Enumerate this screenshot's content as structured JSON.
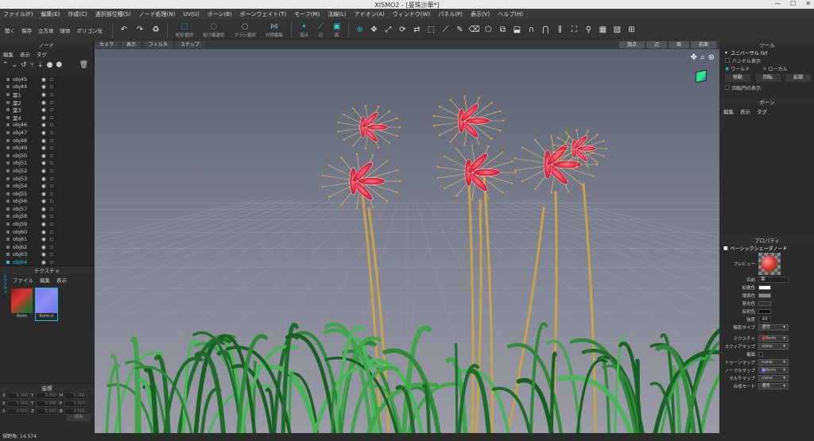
{
  "window": {
    "title": "XISMO2 - [曼珠沙華*]",
    "controls": [
      "—",
      "☐",
      "✕"
    ]
  },
  "menu": [
    "ファイル(F)",
    "編集(E)",
    "作成(C)",
    "選択部位種(S)",
    "ノード処理(N)",
    "UV(U)",
    "ボーン(B)",
    "ボーンウェイト(T)",
    "モーフ(M)",
    "法線(L)",
    "アドオン(A)",
    "ウィンドウ(W)",
    "パネル(P)",
    "表示(V)",
    "ヘルプ(H)"
  ],
  "toolbar": {
    "open": "開く",
    "save": "保存",
    "cube": "立方体",
    "sphere": "球体",
    "polygonize": "ポリゴン化",
    "groups": [
      {
        "label": "矩形選択",
        "active": true
      },
      {
        "label": "投げ縄選択",
        "active": false
      },
      {
        "label": "ブラシ選択",
        "active": false
      },
      {
        "label": "対称編集",
        "active": false
      },
      {
        "label": "頂点",
        "active": true
      },
      {
        "label": "辺",
        "active": true
      },
      {
        "label": "面",
        "active": true
      }
    ]
  },
  "node_panel": {
    "title": "ノード",
    "tabs": [
      "編集",
      "表示",
      "タグ"
    ],
    "items": [
      "obj45",
      "obj44",
      "葉1",
      "葉2",
      "葉3",
      "葉4",
      "obj46",
      "obj47",
      "obj48",
      "obj49",
      "obj50",
      "obj51",
      "obj52",
      "obj53",
      "obj54",
      "obj55",
      "obj56",
      "obj57",
      "obj58",
      "obj59",
      "obj60",
      "obj61",
      "obj62",
      "obj63",
      "obj64"
    ],
    "selected": "obj64"
  },
  "texture_panel": {
    "title": "テクスチャ",
    "tabs": [
      "ファイル",
      "編集",
      "表示"
    ],
    "side_tab": "テクスチャ",
    "thumbs": [
      {
        "label": "form",
        "color": "#c8262a"
      },
      {
        "label": "form-n",
        "color": "#7a7ef0"
      }
    ]
  },
  "coord_panel": {
    "title": "座標",
    "rows": [
      [
        {
          "axis": "X",
          "value": "0.000"
        },
        {
          "axis": "Y",
          "value": "0.000"
        },
        {
          "axis": "H",
          "value": "0.000"
        }
      ],
      [
        {
          "axis": "X",
          "value": "0.000"
        },
        {
          "axis": "Y",
          "value": "0.000"
        },
        {
          "axis": "P",
          "value": "0.000"
        }
      ],
      [
        {
          "axis": "X",
          "value": "0.000"
        },
        {
          "axis": "Z",
          "value": "0.000"
        },
        {
          "axis": "B",
          "value": "0.000"
        }
      ]
    ],
    "apply": "適用"
  },
  "viewport": {
    "menus": [
      "カメラ",
      "表示",
      "フィルタ",
      "スナップ"
    ],
    "views": [
      "頂点",
      "辺",
      "面",
      "前面"
    ]
  },
  "tool_panel": {
    "title": "ツール",
    "mode": "ユニバーサル (V)",
    "handle": "ハンドル表示",
    "world": "ワールド",
    "local": "ローカル",
    "move": "移動",
    "rotate": "回転",
    "scale": "拡縮",
    "rotate_circle": "回転円の表示"
  },
  "bone_panel": {
    "title": "ボーン",
    "tabs": [
      "編集",
      "表示",
      "タグ"
    ]
  },
  "property_panel": {
    "title": "プロパティ",
    "node_type": "ベーシックシェーダノード",
    "preview": "プレビュー",
    "name_label": "名前",
    "name": "葉",
    "diffuse": "拡散色",
    "ambient": "環境色",
    "emissive": "発光色",
    "specular": "反射色",
    "power_label": "強度",
    "power": "44",
    "shading_label": "陰影タイプ",
    "shading": "通常",
    "texture_label": "テクスチャ",
    "texture": "form",
    "sphere_label": "スフィアマップ",
    "sphere": "none",
    "double_label": "裏面",
    "toon_label": "トゥーンマップ",
    "toon": "none",
    "normal_label": "ノーマルマップ",
    "normal": "form",
    "multi_label": "マルチマップ",
    "multi": "none",
    "blend_label": "合成モード",
    "blend": "通常"
  },
  "status": "視野角: 14.574"
}
